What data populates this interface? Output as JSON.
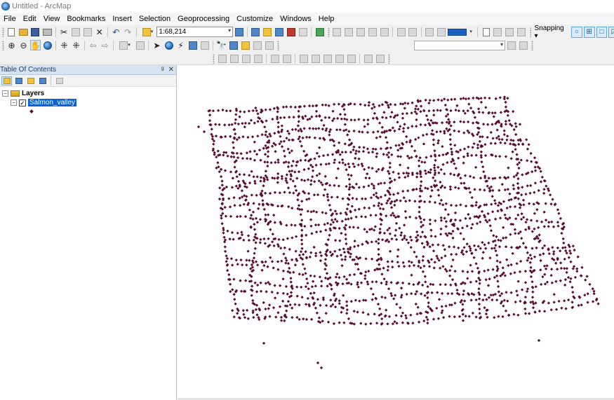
{
  "window": {
    "title": "Untitled - ArcMap"
  },
  "menu": [
    "File",
    "Edit",
    "View",
    "Bookmarks",
    "Insert",
    "Selection",
    "Geoprocessing",
    "Customize",
    "Windows",
    "Help"
  ],
  "toolbar": {
    "scale_value": "1:68,214",
    "snapping_label": "Snapping ▾"
  },
  "toc": {
    "title": "Table Of Contents",
    "root_label": "Layers",
    "layer_name": "Salmon_valley",
    "layer_visible": true
  },
  "map": {
    "point_color": "#5a0a2e",
    "background": "#ffffff"
  },
  "icons": [
    "new-document-icon",
    "open-folder-icon",
    "save-icon",
    "print-icon",
    "cut-icon",
    "copy-icon",
    "paste-icon",
    "delete-icon",
    "undo-icon",
    "redo-icon",
    "add-data-icon",
    "zoom-in-icon",
    "zoom-out-icon",
    "pan-icon",
    "full-extent-icon",
    "select-elements-icon",
    "identify-icon",
    "find-icon",
    "snap-point-icon",
    "snap-end-icon",
    "snap-vertex-icon",
    "snap-edge-icon",
    "pin-icon",
    "close-icon"
  ]
}
